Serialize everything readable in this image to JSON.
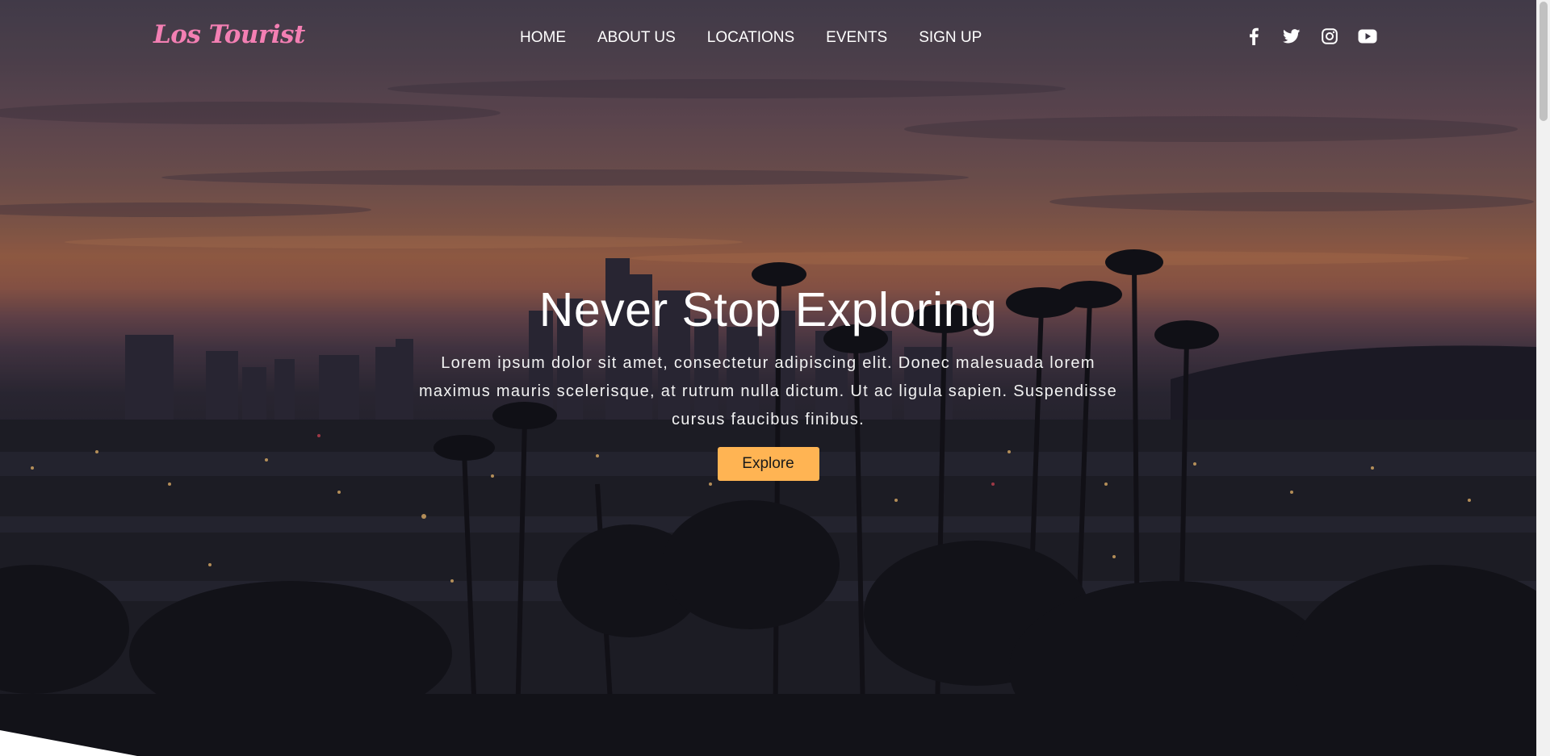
{
  "brand": {
    "logo_text": "Los Tourist",
    "logo_color": "#f37fb3"
  },
  "nav": {
    "links": [
      {
        "label": "HOME"
      },
      {
        "label": "ABOUT US"
      },
      {
        "label": "LOCATIONS"
      },
      {
        "label": "EVENTS"
      },
      {
        "label": "SIGN UP"
      }
    ]
  },
  "social": {
    "icons": [
      "facebook-icon",
      "twitter-icon",
      "instagram-icon",
      "youtube-icon"
    ]
  },
  "hero": {
    "title": "Never Stop Exploring",
    "text": "Lorem ipsum dolor sit amet, consectetur adipiscing elit. Donec malesuada lorem maximus mauris scelerisque, at rutrum nulla dictum. Ut ac ligula sapien. Suspendisse cursus faucibus finibus.",
    "button_label": "Explore",
    "button_color": "#ffb453"
  },
  "colors": {
    "text_primary": "#ffffff",
    "divider": "#ffffff"
  }
}
